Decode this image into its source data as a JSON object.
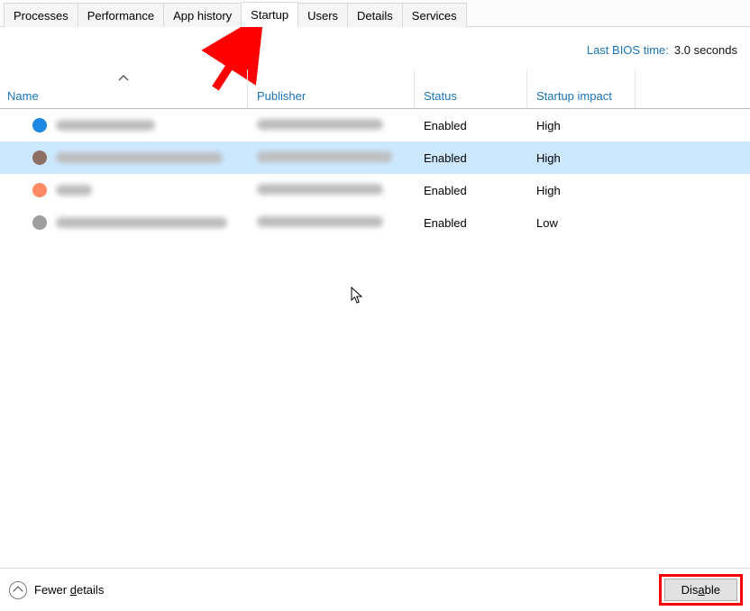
{
  "tabs": [
    {
      "label": "Processes",
      "active": false
    },
    {
      "label": "Performance",
      "active": false
    },
    {
      "label": "App history",
      "active": false
    },
    {
      "label": "Startup",
      "active": true
    },
    {
      "label": "Users",
      "active": false
    },
    {
      "label": "Details",
      "active": false
    },
    {
      "label": "Services",
      "active": false
    }
  ],
  "bios": {
    "label": "Last BIOS time:",
    "value": "3.0 seconds"
  },
  "columns": {
    "name": "Name",
    "publisher": "Publisher",
    "status": "Status",
    "impact": "Startup impact"
  },
  "rows": [
    {
      "icon_color": "#1e88e5",
      "name_blur_w": 110,
      "pub_blur_w": 140,
      "status": "Enabled",
      "impact": "High",
      "selected": false
    },
    {
      "icon_color": "#8d6e63",
      "name_blur_w": 185,
      "pub_blur_w": 150,
      "status": "Enabled",
      "impact": "High",
      "selected": true
    },
    {
      "icon_color": "#ff8a65",
      "name_blur_w": 40,
      "pub_blur_w": 140,
      "status": "Enabled",
      "impact": "High",
      "selected": false
    },
    {
      "icon_color": "#9e9e9e",
      "name_blur_w": 190,
      "pub_blur_w": 140,
      "status": "Enabled",
      "impact": "Low",
      "selected": false
    }
  ],
  "footer": {
    "fewer_details_pre": "Fewer ",
    "fewer_details_underline": "d",
    "fewer_details_post": "etails",
    "disable_pre": "Dis",
    "disable_underline": "a",
    "disable_post": "ble"
  }
}
